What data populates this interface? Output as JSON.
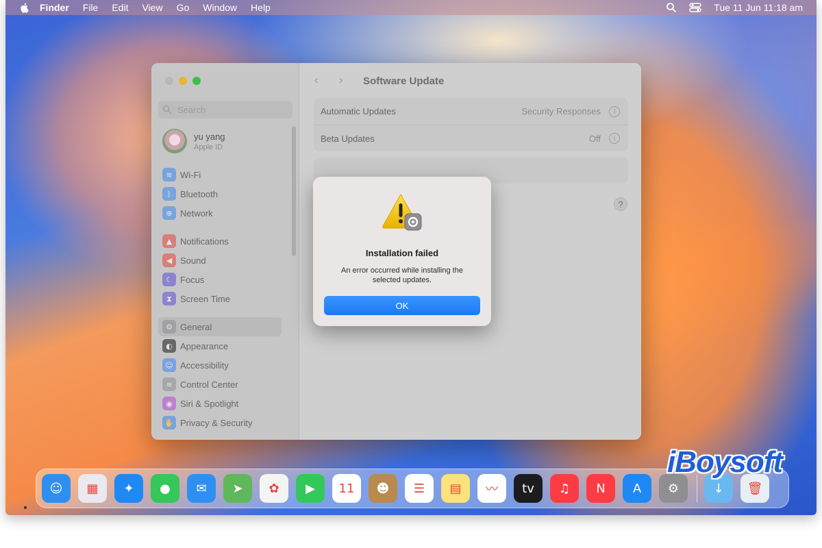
{
  "menubar": {
    "items": [
      {
        "label": "Finder",
        "bold": true
      },
      {
        "label": "File"
      },
      {
        "label": "Edit"
      },
      {
        "label": "View"
      },
      {
        "label": "Go"
      },
      {
        "label": "Window"
      },
      {
        "label": "Help"
      }
    ],
    "clock": "Tue 11 Jun  11:18 am"
  },
  "window": {
    "title": "Software Update",
    "sidebar": {
      "search_placeholder": "Search",
      "profile": {
        "name": "yu yang",
        "subtitle": "Apple ID"
      },
      "groups": [
        [
          {
            "label": "Wi-Fi",
            "icon": "wifi-icon",
            "color": "#3a87f0",
            "glyph": "≋"
          },
          {
            "label": "Bluetooth",
            "icon": "bluetooth-icon",
            "color": "#3a87f0",
            "glyph": "ᛒ"
          },
          {
            "label": "Network",
            "icon": "network-icon",
            "color": "#3a87f0",
            "glyph": "⊕"
          }
        ],
        [
          {
            "label": "Notifications",
            "icon": "notifications-icon",
            "color": "#e8453c",
            "glyph": "▲"
          },
          {
            "label": "Sound",
            "icon": "sound-icon",
            "color": "#e8453c",
            "glyph": "◀"
          },
          {
            "label": "Focus",
            "icon": "focus-icon",
            "color": "#5b4fd6",
            "glyph": "☾"
          },
          {
            "label": "Screen Time",
            "icon": "screen-time-icon",
            "color": "#5b4fd6",
            "glyph": "⧗"
          }
        ],
        [
          {
            "label": "General",
            "icon": "general-icon",
            "color": "#8e8e93",
            "glyph": "⚙",
            "selected": true
          },
          {
            "label": "Appearance",
            "icon": "appearance-icon",
            "color": "#1c1c1e",
            "glyph": "◐"
          },
          {
            "label": "Accessibility",
            "icon": "accessibility-icon",
            "color": "#3a87f0",
            "glyph": "☺"
          },
          {
            "label": "Control Center",
            "icon": "control-center-icon",
            "color": "#8e8e93",
            "glyph": "≡"
          },
          {
            "label": "Siri & Spotlight",
            "icon": "siri-icon",
            "color": "#b34ad6",
            "glyph": "◉"
          },
          {
            "label": "Privacy & Security",
            "icon": "privacy-icon",
            "color": "#3a87f0",
            "glyph": "✋"
          }
        ]
      ]
    },
    "rows": [
      {
        "label": "Automatic Updates",
        "value": "Security Responses"
      },
      {
        "label": "Beta Updates",
        "value": "Off"
      }
    ],
    "help_label": "?"
  },
  "dialog": {
    "title": "Installation failed",
    "message": "An error occurred while installing the selected updates.",
    "ok_label": "OK",
    "icon": "warning-icon"
  },
  "dock": {
    "apps": [
      {
        "name": "finder",
        "color": "#2f8ff0",
        "glyph": "☺"
      },
      {
        "name": "launchpad",
        "color": "#e9e9ef",
        "glyph": "▦"
      },
      {
        "name": "safari",
        "color": "#1e88f5",
        "glyph": "✦"
      },
      {
        "name": "messages",
        "color": "#35c759",
        "glyph": "●"
      },
      {
        "name": "mail",
        "color": "#2f8ff0",
        "glyph": "✉"
      },
      {
        "name": "maps",
        "color": "#5fb85a",
        "glyph": "➤"
      },
      {
        "name": "photos",
        "color": "#f4f4f4",
        "glyph": "✿"
      },
      {
        "name": "facetime",
        "color": "#34c759",
        "glyph": "▶"
      },
      {
        "name": "calendar",
        "color": "#ffffff",
        "glyph": "11"
      },
      {
        "name": "contacts",
        "color": "#b98a4e",
        "glyph": "☻"
      },
      {
        "name": "reminders",
        "color": "#ffffff",
        "glyph": "☰"
      },
      {
        "name": "notes",
        "color": "#fbe27a",
        "glyph": "▤"
      },
      {
        "name": "freeform",
        "color": "#ffffff",
        "glyph": "〰"
      },
      {
        "name": "tv",
        "color": "#1c1c1e",
        "glyph": "tv"
      },
      {
        "name": "music",
        "color": "#fc3c44",
        "glyph": "♫"
      },
      {
        "name": "news",
        "color": "#fc3c44",
        "glyph": "N"
      },
      {
        "name": "app-store",
        "color": "#1e88f5",
        "glyph": "A"
      },
      {
        "name": "system-settings",
        "color": "#8e8e93",
        "glyph": "⚙"
      }
    ],
    "trailing": [
      {
        "name": "downloads",
        "color": "#6ab8f0",
        "glyph": "↓"
      },
      {
        "name": "trash",
        "color": "#e8eef4",
        "glyph": "🗑"
      }
    ]
  },
  "watermark": "iBoysoft"
}
